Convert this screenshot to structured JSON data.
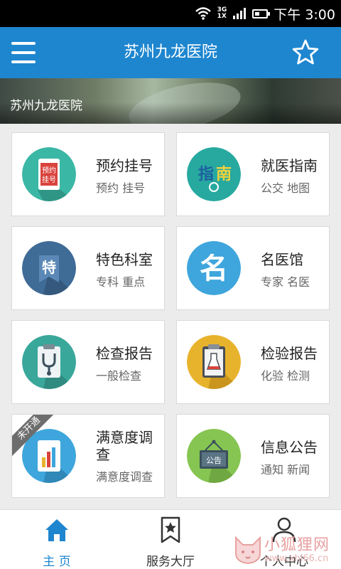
{
  "status_bar": {
    "network": "3G",
    "network_sub": "1X",
    "time": "下午 3:00"
  },
  "header": {
    "title": "苏州九龙医院",
    "menu_icon": "hamburger-menu-icon",
    "favorite_icon": "star-outline-icon"
  },
  "banner": {
    "text": "苏州九龙医院"
  },
  "grid": [
    {
      "title": "预约挂号",
      "subtitle": "预约 挂号",
      "icon": "tablet-register-icon",
      "color": "#3bb7a5",
      "glyph": "预约挂号"
    },
    {
      "title": "就医指南",
      "subtitle": "公交 地图",
      "icon": "guide-compass-icon",
      "color": "#27a9a0",
      "glyph": "指南"
    },
    {
      "title": "特色科室",
      "subtitle": "专科 重点",
      "icon": "special-department-icon",
      "color": "#3f6b97",
      "glyph": "特"
    },
    {
      "title": "名医馆",
      "subtitle": "专家 名医",
      "icon": "famous-doctor-icon",
      "color": "#3ea6dc",
      "glyph": "名"
    },
    {
      "title": "检查报告",
      "subtitle": "一般检查",
      "icon": "stethoscope-report-icon",
      "color": "#3aa79b",
      "glyph": ""
    },
    {
      "title": "检验报告",
      "subtitle": "化验 检测",
      "icon": "lab-flask-report-icon",
      "color": "#e8b32c",
      "glyph": ""
    },
    {
      "title": "满意度调查",
      "subtitle": "满意度调查",
      "icon": "survey-chart-icon",
      "color": "#3ea6dc",
      "glyph": "",
      "ribbon": "未开通"
    },
    {
      "title": "信息公告",
      "subtitle": "通知 新闻",
      "icon": "notice-board-icon",
      "color": "#86c552",
      "glyph": "公告"
    }
  ],
  "bottom_nav": [
    {
      "label": "主 页",
      "icon": "home-icon",
      "active": true
    },
    {
      "label": "服务大厅",
      "icon": "service-bookmark-icon",
      "active": false
    },
    {
      "label": "个人中心",
      "icon": "person-icon",
      "active": false
    }
  ],
  "watermark": {
    "text": "小狐狸网",
    "url": "www.xhl66.cn",
    "icon": "fox-logo-icon"
  },
  "colors": {
    "primary": "#1e86cf",
    "background": "#ececec",
    "card": "#ffffff"
  }
}
